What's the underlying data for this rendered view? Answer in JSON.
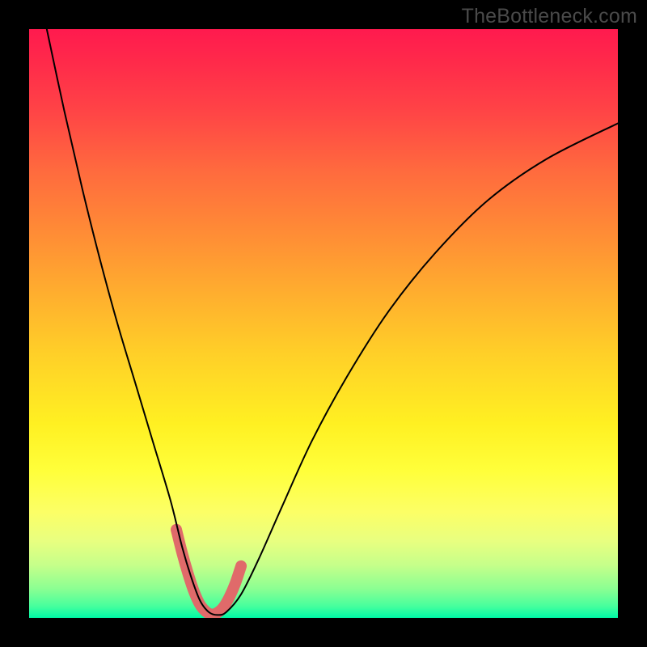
{
  "watermark": "TheBottleneck.com",
  "chart_data": {
    "type": "line",
    "title": "",
    "xlabel": "",
    "ylabel": "",
    "xlim": [
      0,
      100
    ],
    "ylim": [
      0,
      100
    ],
    "grid": false,
    "series": [
      {
        "name": "curve",
        "color": "#000000",
        "stroke_width": 2.0,
        "x": [
          3,
          6,
          9,
          12,
          15,
          18,
          21,
          24,
          26,
          27.5,
          29,
          30.5,
          32,
          33.5,
          36,
          39,
          43,
          48,
          54,
          61,
          69,
          78,
          88,
          100
        ],
        "y": [
          100,
          86,
          73,
          61,
          50,
          40,
          30,
          20,
          12,
          7,
          3,
          1,
          0.5,
          1,
          4,
          10,
          19,
          30,
          41,
          52,
          62,
          71,
          78,
          84
        ]
      },
      {
        "name": "highlight",
        "color": "#e06a6a",
        "stroke_width": 14,
        "linecap": "round",
        "x": [
          25,
          26,
          27,
          28,
          29,
          30,
          31,
          32,
          33,
          34,
          35,
          36
        ],
        "y": [
          15,
          11,
          7.5,
          4.5,
          2.3,
          1.1,
          0.6,
          0.9,
          1.8,
          3.5,
          5.8,
          8.8
        ]
      }
    ]
  }
}
